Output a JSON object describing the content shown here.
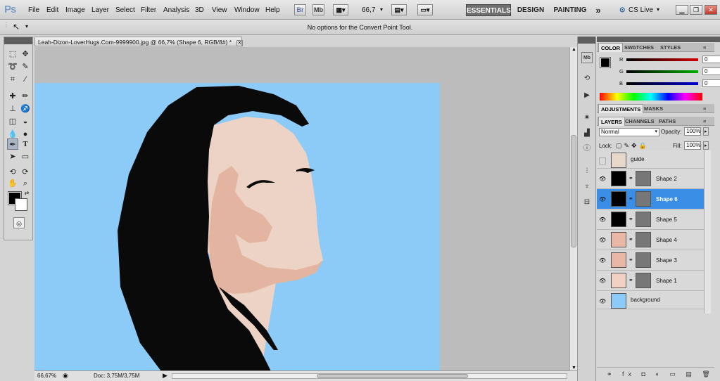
{
  "menubar": {
    "logo": "Ps",
    "items": [
      "File",
      "Edit",
      "Image",
      "Layer",
      "Select",
      "Filter",
      "Analysis",
      "3D",
      "View",
      "Window",
      "Help"
    ],
    "bridge": "Br",
    "minibridge": "Mb",
    "zoom": "66,7",
    "workspaces": [
      "ESSENTIALS",
      "DESIGN",
      "PAINTING"
    ],
    "more": "»",
    "cslive": "CS Live"
  },
  "options": {
    "text": "No options for the Convert Point Tool."
  },
  "document": {
    "tab_title": "Leah-Dizon-LoverHugs.Com-9999900.jpg @ 66,7% (Shape 6, RGB/8#) *",
    "zoom_status": "66,67%",
    "doc_status": "Doc: 3,75M/3,75M"
  },
  "color_panel": {
    "tabs": [
      "COLOR",
      "SWATCHES",
      "STYLES"
    ],
    "sliders": [
      {
        "label": "R",
        "value": "0",
        "color": "#d40000"
      },
      {
        "label": "G",
        "value": "0",
        "color": "#00b000"
      },
      {
        "label": "B",
        "value": "0",
        "color": "#0000d0"
      }
    ]
  },
  "adjustments_panel": {
    "tabs": [
      "ADJUSTMENTS",
      "MASKS"
    ]
  },
  "layers_panel": {
    "tabs": [
      "LAYERS",
      "CHANNELS",
      "PATHS"
    ],
    "blend_mode": "Normal",
    "opacity_label": "Opacity:",
    "opacity_value": "100%",
    "lock_label": "Lock:",
    "fill_label": "Fill:",
    "fill_value": "100%",
    "layers": [
      {
        "name": "guide",
        "thumb_color": "#e8d8cc",
        "mask": false,
        "visible": false,
        "selected": false
      },
      {
        "name": "Shape 2",
        "thumb_color": "#000000",
        "mask": true,
        "visible": true,
        "selected": false
      },
      {
        "name": "Shape 6",
        "thumb_color": "#000000",
        "mask": true,
        "visible": true,
        "selected": true
      },
      {
        "name": "Shape 5",
        "thumb_color": "#000000",
        "mask": true,
        "visible": true,
        "selected": false
      },
      {
        "name": "Shape 4",
        "thumb_color": "#e9b7a6",
        "mask": true,
        "visible": true,
        "selected": false
      },
      {
        "name": "Shape 3",
        "thumb_color": "#e9b7a6",
        "mask": true,
        "visible": true,
        "selected": false
      },
      {
        "name": "Shape 1",
        "thumb_color": "#f0d2c4",
        "mask": true,
        "visible": true,
        "selected": false
      },
      {
        "name": "background",
        "thumb_color": "#8ccbf7",
        "mask": false,
        "visible": true,
        "selected": false
      }
    ]
  },
  "colors": {
    "canvas_background": "#8ccbf7",
    "hair": "#0a0a0a",
    "skin": "#edd3c6",
    "shadow": "#e3b5a0",
    "selection": "#3a8ee6",
    "foreground": "#000000",
    "background": "#ffffff"
  }
}
